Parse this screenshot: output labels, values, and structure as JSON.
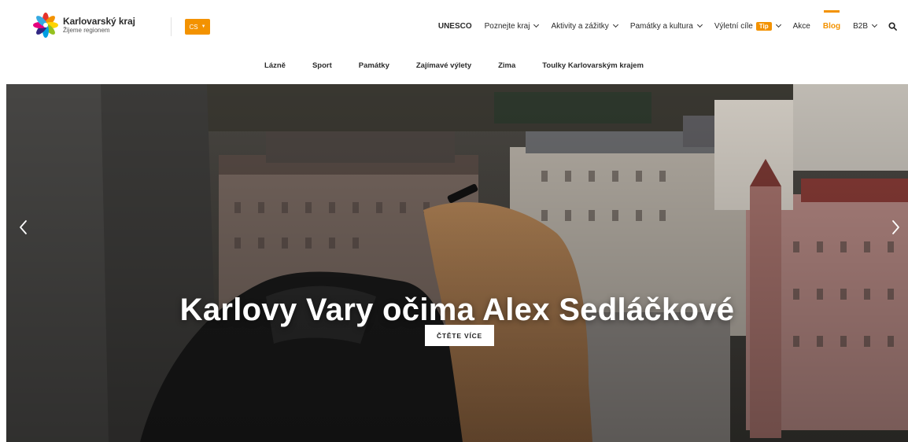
{
  "brand": {
    "title": "Karlovarský kraj",
    "subtitle": "Žijeme regionem"
  },
  "language": {
    "selected": "CS"
  },
  "topnav": {
    "unesco": "UNESCO",
    "poznejte": "Poznejte kraj",
    "aktivity": "Aktivity a zážitky",
    "pamatky": "Památky a kultura",
    "vyletni": "Výletní cíle",
    "vyletni_badge": "Tip",
    "akce": "Akce",
    "blog": "Blog",
    "b2b": "B2B"
  },
  "subnav": {
    "items": [
      "Lázně",
      "Sport",
      "Památky",
      "Zajímavé výlety",
      "Zima",
      "Toulky Karlovarským krajem"
    ]
  },
  "hero": {
    "title": "Karlovy Vary očima Alex Sedláčkové",
    "cta": "ČTĚTE VÍCE"
  },
  "colors": {
    "accent": "#f39200",
    "text": "#2a2a2a"
  },
  "icons": {
    "search": "search-icon",
    "prev": "chevron-left-icon",
    "next": "chevron-right-icon",
    "dropdown": "chevron-down-icon"
  }
}
